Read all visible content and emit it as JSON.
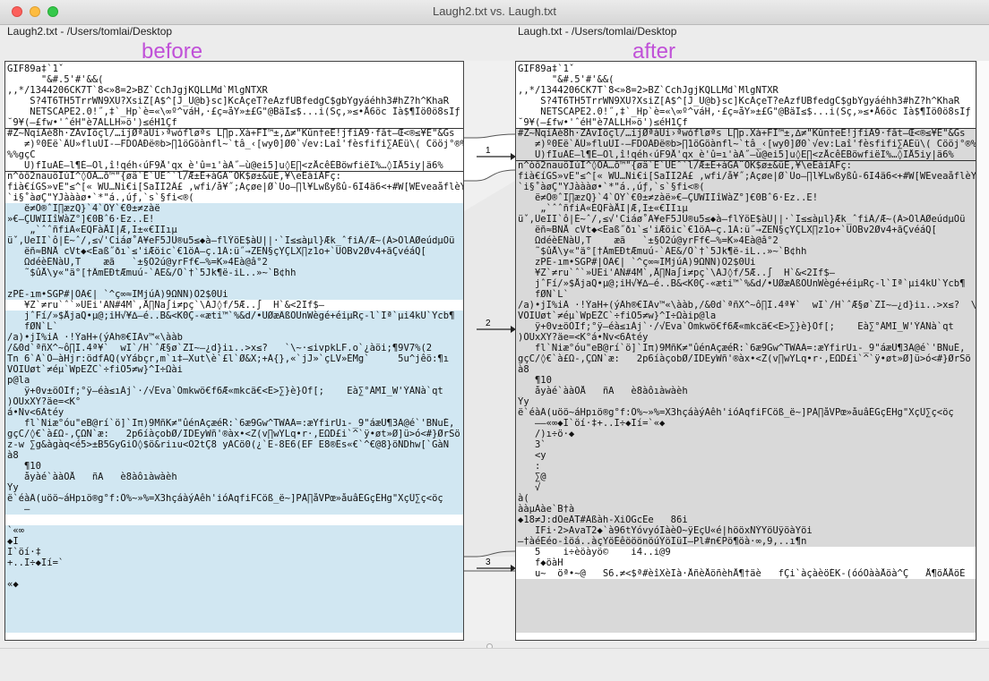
{
  "window": {
    "title": "Laugh2.txt vs. Laugh.txt"
  },
  "left": {
    "path": "Laugh2.txt - /Users/tomlai/Desktop",
    "label": "before",
    "lines": [
      "GIF89a‡`1ˇ",
      "      \"&#.5'#'&&(",
      ",,*/1344206CK7T`8<»8=2>BZ`CchJgjKQLLMd`MlgNTXR",
      "    S?4T6TH5TrrWN9XU?XsiZ[A$^[J_U@b}sc]KcÄçeT?eÄzfUBfedgC$gbYgyáéhh3#hZ?h^KhaR",
      "    NETSCAPE2.0!˝,‡`_Hp`è=«\\∞º^váH,·£ç≈åY»±£G\"@BäI≤$...i(Sç,»≤•Å6öc Ià$¶Îö0ö8sIƒ",
      "˘9¥(–£fw•'ˆéH\"è7ÄLLH»ö')≤éH1Çf",
      "#Z~NqiÀè8h·ZÀvIöçl/…ijØªàÜi›ªwófløªs L∏p.Xà+FI™±,∆≠\"Kûn†eE!jfiA9·fåt–Œ<®≤¥E\"&Gs",
      "   ≠)º0Eë`ÂÛ»fluUI-–FDOÄÐë®b>∏1öGöànfl~`tâ_‹[wy0]Ø0`√ev:Laî'fèsfifi∑ÄÉü\\( Cööj°®%",
      "%%gçC",
      "   Ü)fIuÄÉ–l¶É–Öl,î!qéh‹úF9Å'qx_è'û=ı'àÄ˝–ù@ei5]u◊E∏<zÅcêÈBöwfiëÏ%…◊IÅ5iy|ä6%",
      "n^òô2nauöIúI^◊ÖÄ…õ™\"{øä`Ë`ÛEˆ`l/Æ±E+àGÄ¨ÖK$ø±&üÉ,¥\\eEàíÄFç:",
      "fià€íGS»vE\"≤^[« WU…Ñi€i[SaÎI2Â£ ,wfi/å¥˝;Äçøe|Ø`Üo–∏l¥Lwßyßû-6I4ä6<+#W[WEveaåflèY",
      "`i§˚àøÇ\"YJàààø•`*\"á.,úƒ,`s`§fi<®(",
      "   ë≠Ö®ˆI∏æzQ}`4`ÖY`€0±≠zàë",
      "»€–ÇUWIIîWàZ°]€0Bˆ6·Ez..E!",
      "    „`ˆˆñfiÄ«ÉQFàÅI|Æ,I±«€IIıµ",
      "üˇ,ÛeII`ô|É~ˆ/,≤√'Ciáø˚A¥eF5JÜ®u5≤◆à–flÝöE$àU||·`I≤≤àµl}Æk_ˆfiÄ/Æ~(Ä>ÓlÄØeúdµOü",
      "   ëñ≈BÑÅ cVt◆<Éaß˝ðı`≤'iÆöic`€1öA–ç.1Ä:ü˝→ZEÑ§çYÇLX∏z1o+`UÓBv2Øv4+ãÇvéáQ[",
      "   ΩdéèÉÑàU,T    æã   `±§Ö2ú@yrFf€–%=K»4Eà@â°2",
      "   ˜$ûÅ\\y«\"ä°[†ÂmEÐtÆmuú-`ÄE&/Ô`†`5Jk¶ë-iL..»~`B¢hh",
      "",
      "zPÉ-ım•SGP#|ÖÄ€| `^ç∞≈IMjúÄ)9ΩÑN)Ö2$0Ui",
      "   ¥Z`≠ru`ˆ`»ÛEi'ÄÑ#4M`,Å∏Ña∫i≠pç`\\ÄJ◊f/5Æ..∫  H`&<2If$–",
      "   jˆFí/»$ÅjaQ•μ@;iH√¥∆–é..B&<K0Ç-«æti™`%&d/•UØæÄßÖUnWègé+éiμRç-l`Iª`μi4kU`Ycb¶",
      "   fØÑ`L`",
      "/a)•jI%iÄ ·!ÝaH+(ýÄh®€IÄv™«\\ààb",
      "/&0d`ªñX^~ô∏I.4ª¥`  wI`/H`ˆÆ§ø`ZI~–¿d}iı..>x≤?   `\\~·≤ivpkLF.o`¿àöi;¶9V7%(2",
      "Tn 6`Ä`Ö–àHjr:ödfAQ(vYábçr,m`ı‡–Xut\\è`£l`Ø&X;+Ä{},«`jJ»`çLV»ÈMg`     5u^jêö:¶ı",
      "VÖIUøt`≠éμ`WpEŽC`÷fiÕ5≠w}^I÷Ωài",
      "p@la",
      "   ÿ+0v±öÒIf;°ÿ–éà≤ıÀj`·/√Eva`Ómkwö€f6Æ«mkcä€<E>∑}è}Öf[;    Eà∑°ÁMI_W'ÝÀNà`qt",
      ")ÖUxXY?äe=<K°",
      "á•Nv<6Ätéy",
      "   fl`Niæ°óu\"eB@rí`ö]`Iπ)9MñK≠\"ûénAçæéR:`6æ9Gw^TWAÄ=:æYfirUı-_9\"áæÜ¶3Ä@é`'BNuÉ,",
      "gçC/◊€`à£Ω-,ÇΩN`æ:   2p6íàçobØ/IDEyWñ'®àx•<Z(v∏wYLq•r·,EΩD£i`^`ÿ•øt»Ø]ü>ó<#}ØrSö",
      "z-w ∑g&àgàq<é5>±B5GyGiÖ◊$ö&riıu<Ö2tÇ8 yACö0(¿`E-8E6(EF E8®És«€`^€@8}öÑDhw[`GàÑ",
      "à8",
      "   ¶10",
      "   åyàé`ààÖÅ   ñA   è8àôıàwàèh",
      "Ÿy",
      "ë`éàÄ(uöö~áHpıö®g°f:Ö%~»%=X3hçáàýAêh'ióAqfiFCöß_ë~]PÀ∏åVPœ»åuâÉGçÉHg\"XçÜ∑ç<öç",
      "   –",
      "",
      "`«∞",
      "◆I",
      "I`öí·‡",
      "+..I÷◆Ií=`",
      "",
      "«◆"
    ]
  },
  "right": {
    "path": "Laugh.txt - /Users/tomlai/Desktop",
    "label": "after",
    "lines": [
      "GIF89a‡`1ˇ",
      "      \"&#.5'#'&&(",
      ",,*/1344206CK7T`8<»8=2>BZ`CchJgjKQLLMd`MlgNTXR",
      "    S?4T6TH5TrrWN9XU?XsiZ[A$^[J_U@b}sc]KcÄçeT?eÄzfUBfedgC$gbYgyáéhh3#hZ?h^KhaR",
      "    NETSCAPE2.0!˝,‡`_Hp`è=«\\∞º^váH,·£ç≈åY»±£G\"@BäI≤$...i(Sç,»≤•Å6öc Ià$¶Îö0ö8sIƒ",
      "˘9¥(–£fw•'ˆéH\"è7ÄLLH»ö')≤éH1Çf",
      "#Z~NqiÀè8h·ZÀvIöçl/…ijØªàÜi›ªwófløªs L∏p.Xà+FI™±,∆≠\"Kûn†eE!jfiA9·fåt–Œ<®≤¥E\"&Gs",
      "   ≠)º0Eë`ÂÛ»fluUI-–FDOÄÐë®b>∏1öGöànfl~`tâ_‹[wy0]Ø0`√ev:Laî'fèsfifi∑ÄÉü\\( Cööj°®%",
      "   Ü)fIuÄÉ–l¶É–Öl,î!qéh‹úF9Å'qx_è'û=ı'àÄ˝–ù@ei5]u◊E∏<zÅcêÈBöwfiëÏ%…◊IÅ5iy|ä6%",
      "n^òô2nauöIúI^◊ÖÄ…õ™\"{øä`Ë`ÛEˆ`l/Æ±E+àGÄ¨ÖK$ø±&üÉ,¥\\eEàíÄFç:",
      "fià€íGS»vE\"≤^[« WU…Ñi€i[SaÎI2Â£ ,wfi/å¥˝;Äçøe|Ø`Üo–∏l¥Lwßyßû-6I4ä6<+#W[WEveaåflèY",
      "`i§˚àøÇ\"YJàààø•`*\"á.,úƒ,`s`§fi<®(",
      "   ë≠Ö®ˆI∏æzQ}`4`ÖY`€0±≠zàë»€–ÇUWIIîWàZ°]€0Bˆ6·Ez..E!",
      "    „`ˆˆñfiÄ«ÉQFàÅI|Æ,I±«€IIıµ",
      "üˇ,ÛeII`ô|É~ˆ/,≤√'Ciáø˚A¥eF5JÜ®u5≤◆à–flÝöE$àU||·`I≤≤àµl}Æk_ˆfiÄ/Æ~(Ä>ÓlÄØeúdµOü",
      "   ëñ≈BÑÅ cVt◆<Éaß˝ðı`≤'iÆöic`€1öA–ç.1Ä:ü˝→ZEÑ§çYÇLX∏z1o+`UÓBv2Øv4+ãÇvéáQ[",
      "   ΩdéèÉÑàU,T    æã   `±§Ö2ú@yrFf€–%=K»4Eà@â°2",
      "   ˜$ûÅ\\y«\"ä°[†ÂmEÐtÆmuú-`ÄE&/Ô`†`5Jk¶ë-iL..»~`B¢hh",
      "   zPÉ-ım•SGP#|ÖÄ€| `^ç∞≈IMjúÄ)9ΩÑN)Ö2$0Ui",
      "   ¥Z`≠ru`ˆ`»ÛEi'ÄÑ#4M`,Å∏Ña∫i≠pç`\\ÄJ◊f/5Æ..∫  H`&<2If$–",
      "   jˆFí/»$ÅjaQ•μ@;iH√¥∆–é..B&<K0Ç-«æti™`%&d/•UØæÄßÖUnWègé+éiμRç-l`Iª`μi4kU`Ycb¶",
      "   fØÑ`L`",
      "/a)•jI%iÄ ·!ÝaH+(ýÄh®€IÄv™«\\ààb,/&0d`ªñX^~ô∏I.4ª¥`  wI`/H`ˆÆ§ø`ZI~–¿d}iı..>x≤?  \\",
      "VÖIUøt`≠éμ`WpEŽC`÷fiÕ5≠w}^I÷Ωàip@la",
      "   ÿ+0v±öÒIf;°ÿ–éà≤ıÀj`·/√Eva`Ómkwö€f6Æ«mkcä€<E>∑}è}Öf[;    Eà∑°ÁMI_W'ÝÀNà`qt",
      ")ÖUxXY?äe=<K°á•Nv<6Ätéy",
      "   fl`Niæ°óu\"eB@rí`ö]`Iπ)9MñK≠\"ûénAçæéR:`6æ9Gw^TWAÄ=:æYfirUı-_9\"áæÜ¶3Ä@é`'BNuÉ,",
      "gçC/◊€`à£Ω-,ÇΩN`æ:   2p6íàçobØ/IDEyWñ'®àx•<Z(v∏wYLq•r·,EΩD£i`^`ÿ•øt»Ø]ü>ó<#}ØrSö",
      "à8",
      "   ¶10",
      "   åyàé`ààÖÅ   ñA   è8àôıàwàèh",
      "Ÿy",
      "ë`éàÄ(uöö~áHpıö®g°f:Ö%~»%=X3hçáàýAêh'ióAqfiFCöß_ë~]PÀ∏åVPœ»åuâÉGçÉHg\"XçÜ∑ç<öç",
      "   ––«∞◆I`öí·‡+..I÷◆Ií=`«◆",
      "   /)ı÷ö·◆",
      "   3`",
      "   <y",
      "   :",
      "   ∑@",
      "   √",
      "à(",
      "ààμÀàe`B†à",
      "◆18≠J:dÖeÄT#Äßàh-XiÖGcËe   86i",
      "   IFi·2>AvaT2◆`à96tYóvyóIàèÖ~ÿEçU«é|hööxÑÝYöUÿöàYöi",
      "–†àéÉéo-îöá..àçYöÉêööönöúÝöIüI–Pl#n€Pö¶öà·∞,9,..ı¶n",
      "   5    i÷èöàyö©    i4..i@9",
      "   f◆öàH",
      "   u~  öª•~@   S6.≠<$ª#èîXèIà·ÅñèÅöñèhÅ¶†äè   fÇi`àçàèöÉK-(óóÖààÅöà^Ç   Å¶öÅÅöÉ"
    ]
  },
  "diff_markers": [
    "1",
    "2",
    "3"
  ],
  "colors": {
    "label": "#c050d8",
    "changed_left": "#d1e7f2",
    "changed_right": "#d9d9d9",
    "path_highlight": "#f3d5f0"
  }
}
